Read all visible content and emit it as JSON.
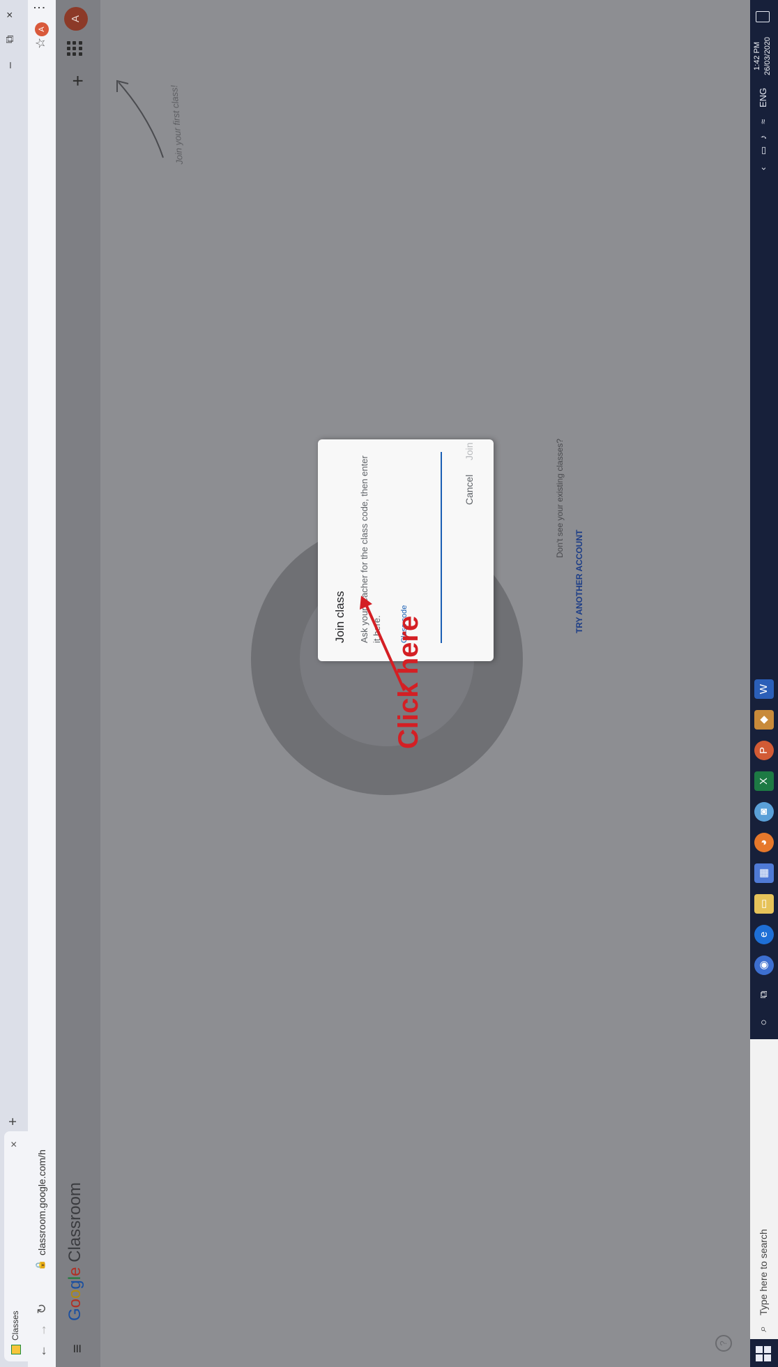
{
  "browser": {
    "tab_title": "Classes",
    "tab_close": "×",
    "new_tab": "+",
    "url": "classroom.google.com/h",
    "window_buttons": {
      "minimize": "–",
      "restore": "⧉",
      "close": "×"
    },
    "profile_initial": "A",
    "menu": "⋮"
  },
  "app": {
    "logo_parts": [
      "G",
      "o",
      "o",
      "g",
      "l",
      "e"
    ],
    "product": "Classroom",
    "add_button": "+",
    "avatar_initial": "A",
    "join_hint": "Join your first class!"
  },
  "dialog": {
    "title": "Join class",
    "description": "Ask your teacher for the class code, then enter it here.",
    "field_label": "Class code",
    "field_value": "",
    "cancel_label": "Cancel",
    "join_label": "Join"
  },
  "empty_state": {
    "question": "Don't see your existing classes?",
    "try_another": "TRY ANOTHER ACCOUNT"
  },
  "annotation": {
    "text": "Click here",
    "color": "#d41f24"
  },
  "taskbar": {
    "search_placeholder": "Type here to search",
    "language": "ENG",
    "time": "1:42 PM",
    "date": "26/03/2020",
    "pinned_apps": [
      "cortana-icon",
      "task-view-icon",
      "chrome-icon",
      "edge-icon",
      "file-explorer-icon",
      "store-icon",
      "firefox-icon",
      "photos-icon",
      "excel-icon",
      "powerpoint-icon",
      "app-icon",
      "word-icon"
    ]
  }
}
